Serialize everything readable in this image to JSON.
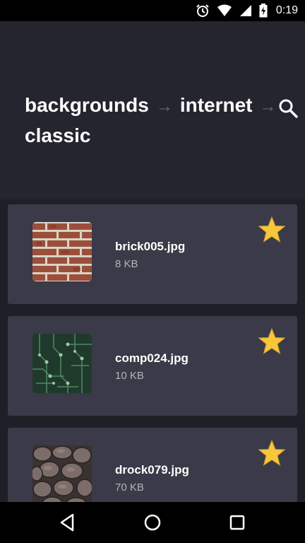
{
  "status_bar": {
    "time": "0:19",
    "icons": [
      "alarm-icon",
      "wifi-icon",
      "signal-icon",
      "battery-charging-icon"
    ]
  },
  "header": {
    "breadcrumb": [
      "backgrounds",
      "internet",
      "classic"
    ],
    "separator": "→",
    "search_icon": "search-icon"
  },
  "files": [
    {
      "name": "brick005.jpg",
      "size": "8 KB",
      "favorite": true
    },
    {
      "name": "comp024.jpg",
      "size": "10 KB",
      "favorite": true
    },
    {
      "name": "drock079.jpg",
      "size": "70 KB",
      "favorite": true
    }
  ],
  "nav_bar": {
    "icons": [
      "back-icon",
      "home-icon",
      "recents-icon"
    ]
  },
  "colors": {
    "background": "#25252f",
    "card": "#3a3a48",
    "star": "#f7c63b",
    "secondary_text": "#b4b4bd"
  }
}
